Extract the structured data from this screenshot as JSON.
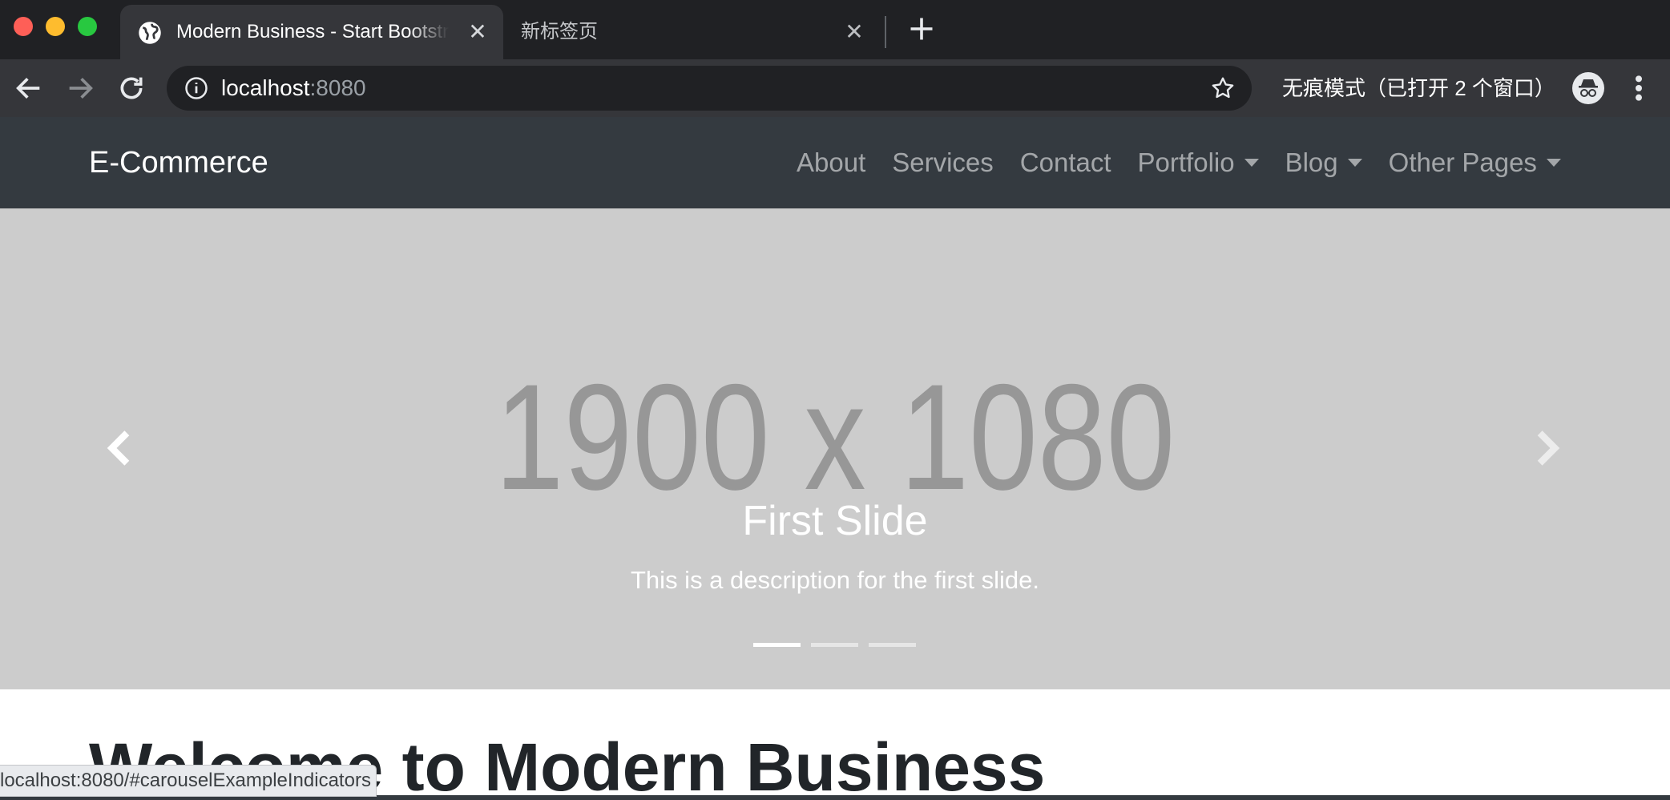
{
  "browser": {
    "tabs": [
      {
        "title": "Modern Business - Start Bootstrap Template",
        "active": true,
        "favicon": "globe-icon"
      },
      {
        "title": "新标签页",
        "active": false
      }
    ],
    "new_tab_label": "+",
    "address": {
      "host": "localhost",
      "port": ":8080"
    },
    "incognito_text": "无痕模式（已打开 2 个窗口）",
    "status_url": "localhost:8080/#carouselExampleIndicators"
  },
  "navbar": {
    "brand": "E-Commerce",
    "items": [
      {
        "label": "About",
        "dropdown": false
      },
      {
        "label": "Services",
        "dropdown": false
      },
      {
        "label": "Contact",
        "dropdown": false
      },
      {
        "label": "Portfolio",
        "dropdown": true
      },
      {
        "label": "Blog",
        "dropdown": true
      },
      {
        "label": "Other Pages",
        "dropdown": true
      }
    ]
  },
  "carousel": {
    "placeholder_text": "1900 x 1080",
    "caption_title": "First Slide",
    "caption_description": "This is a description for the first slide.",
    "indicator_count": 3,
    "active_indicator": 0
  },
  "main": {
    "heading": "Welcome to Modern Business"
  },
  "colors": {
    "navbar_bg": "#343a40",
    "carousel_bg": "#cccccc",
    "chrome_dark": "#202124",
    "chrome_toolbar": "#35363a"
  }
}
